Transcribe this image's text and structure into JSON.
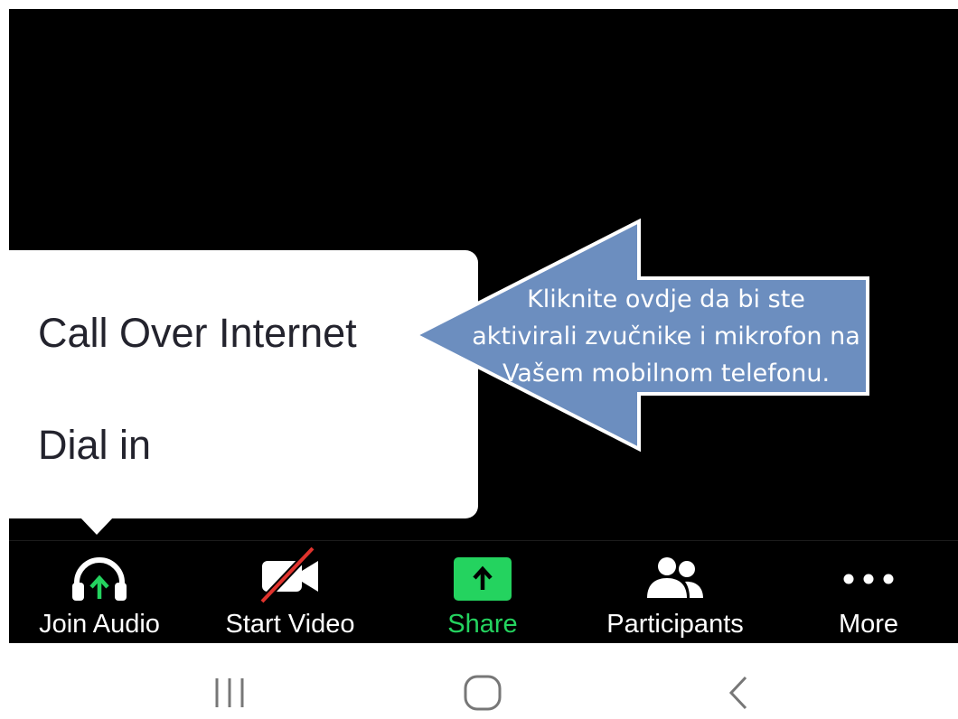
{
  "audio_menu": {
    "items": [
      {
        "label": "Call Over Internet"
      },
      {
        "label": "Dial in"
      }
    ]
  },
  "callout": {
    "lines": [
      "Kliknite ovdje da bi ste",
      "aktivirali zvučnike i mikrofon na",
      "Vašem mobilnom telefonu."
    ],
    "fill_color": "#6c8ebf",
    "border_color": "#ffffff"
  },
  "toolbar": {
    "items": [
      {
        "label": "Join Audio",
        "icon": "headphones-icon"
      },
      {
        "label": "Start Video",
        "icon": "video-off-icon"
      },
      {
        "label": "Share",
        "icon": "share-icon"
      },
      {
        "label": "Participants",
        "icon": "participants-icon"
      },
      {
        "label": "More",
        "icon": "more-icon"
      }
    ],
    "accent_color": "#24d35f"
  },
  "system_nav": {
    "buttons": [
      {
        "icon": "recent-apps-icon"
      },
      {
        "icon": "home-icon"
      },
      {
        "icon": "back-icon"
      }
    ]
  }
}
